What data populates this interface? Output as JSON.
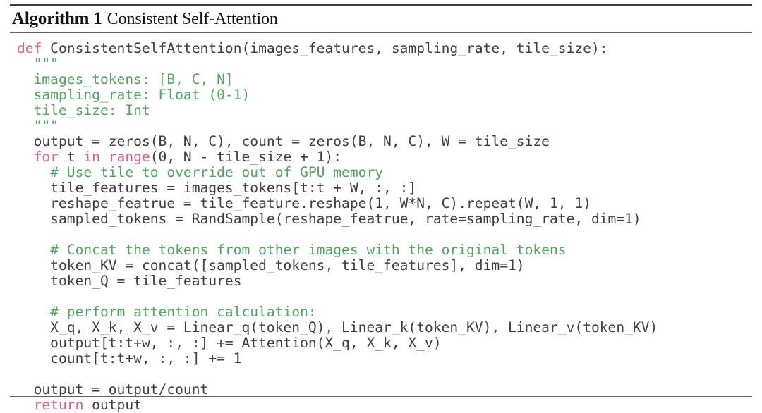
{
  "algorithm": {
    "label": "Algorithm 1",
    "caption": "Consistent Self-Attention",
    "colors": {
      "keyword": "#e0608f",
      "comment": "#51a75f",
      "docstring": "#51a75f",
      "code": "#3c4043",
      "rule": "#5d6266",
      "background": "#ffffff"
    },
    "language": "python",
    "code_lines": [
      {
        "index": 1,
        "text": "def ConsistentSelfAttention(images_features, sampling_rate, tile_size):",
        "segments": [
          {
            "kind": "keyword",
            "text": "def"
          },
          {
            "kind": "code",
            "text": " ConsistentSelfAttention(images_features, sampling_rate, tile_size):"
          }
        ]
      },
      {
        "index": 2,
        "text": "  \"\"\"",
        "segments": [
          {
            "kind": "docstring",
            "text": "  \"\"\""
          }
        ]
      },
      {
        "index": 3,
        "text": "  images_tokens: [B, C, N]",
        "segments": [
          {
            "kind": "docstring",
            "text": "  images_tokens: [B, C, N]"
          }
        ]
      },
      {
        "index": 4,
        "text": "  sampling_rate: Float (0-1)",
        "segments": [
          {
            "kind": "docstring",
            "text": "  sampling_rate: Float (0-1)"
          }
        ]
      },
      {
        "index": 5,
        "text": "  tile_size: Int",
        "segments": [
          {
            "kind": "docstring",
            "text": "  tile_size: Int"
          }
        ]
      },
      {
        "index": 6,
        "text": "  \"\"\"",
        "segments": [
          {
            "kind": "docstring",
            "text": "  \"\"\""
          }
        ]
      },
      {
        "index": 7,
        "text": "  output = zeros(B, N, C), count = zeros(B, N, C), W = tile_size",
        "segments": [
          {
            "kind": "code",
            "text": "  output = zeros(B, N, C), count = zeros(B, N, C), W = tile_size"
          }
        ]
      },
      {
        "index": 8,
        "text": "  for t in range(0, N - tile_size + 1):",
        "segments": [
          {
            "kind": "code",
            "text": "  "
          },
          {
            "kind": "keyword",
            "text": "for"
          },
          {
            "kind": "code",
            "text": " t "
          },
          {
            "kind": "keyword",
            "text": "in"
          },
          {
            "kind": "code",
            "text": " "
          },
          {
            "kind": "keyword",
            "text": "range"
          },
          {
            "kind": "code",
            "text": "(0, N - tile_size + 1):"
          }
        ]
      },
      {
        "index": 9,
        "text": "    # Use tile to override out of GPU memory",
        "segments": [
          {
            "kind": "comment",
            "text": "    # Use tile to override out of GPU memory"
          }
        ]
      },
      {
        "index": 10,
        "text": "    tile_features = images_tokens[t:t + W, :, :]",
        "segments": [
          {
            "kind": "code",
            "text": "    tile_features = images_tokens[t:t + W, :, :]"
          }
        ]
      },
      {
        "index": 11,
        "text": "    reshape_featrue = tile_feature.reshape(1, W*N, C).repeat(W, 1, 1)",
        "segments": [
          {
            "kind": "code",
            "text": "    reshape_featrue = tile_feature.reshape(1, W*N, C).repeat(W, 1, 1)"
          }
        ]
      },
      {
        "index": 12,
        "text": "    sampled_tokens = RandSample(reshape_featrue, rate=sampling_rate, dim=1)",
        "segments": [
          {
            "kind": "code",
            "text": "    sampled_tokens = RandSample(reshape_featrue, rate=sampling_rate, dim=1)"
          }
        ]
      },
      {
        "index": 13,
        "text": "",
        "segments": []
      },
      {
        "index": 14,
        "text": "    # Concat the tokens from other images with the original tokens",
        "segments": [
          {
            "kind": "comment",
            "text": "    # Concat the tokens from other images with the original tokens"
          }
        ]
      },
      {
        "index": 15,
        "text": "    token_KV = concat([sampled_tokens, tile_features], dim=1)",
        "segments": [
          {
            "kind": "code",
            "text": "    token_KV = concat([sampled_tokens, tile_features], dim=1)"
          }
        ]
      },
      {
        "index": 16,
        "text": "    token_Q = tile_features",
        "segments": [
          {
            "kind": "code",
            "text": "    token_Q = tile_features"
          }
        ]
      },
      {
        "index": 17,
        "text": "",
        "segments": []
      },
      {
        "index": 18,
        "text": "    # perform attention calculation:",
        "segments": [
          {
            "kind": "comment",
            "text": "    # perform attention calculation:"
          }
        ]
      },
      {
        "index": 19,
        "text": "    X_q, X_k, X_v = Linear_q(token_Q), Linear_k(token_KV), Linear_v(token_KV)",
        "segments": [
          {
            "kind": "code",
            "text": "    X_q, X_k, X_v = Linear_q(token_Q), Linear_k(token_KV), Linear_v(token_KV)"
          }
        ]
      },
      {
        "index": 20,
        "text": "    output[t:t+w, :, :] += Attention(X_q, X_k, X_v)",
        "segments": [
          {
            "kind": "code",
            "text": "    output[t:t+w, :, :] += Attention(X_q, X_k, X_v)"
          }
        ]
      },
      {
        "index": 21,
        "text": "    count[t:t+w, :, :] += 1",
        "segments": [
          {
            "kind": "code",
            "text": "    count[t:t+w, :, :] += 1"
          }
        ]
      },
      {
        "index": 22,
        "text": "",
        "segments": []
      },
      {
        "index": 23,
        "text": "  output = output/count",
        "segments": [
          {
            "kind": "code",
            "text": "  output = output/count"
          }
        ]
      },
      {
        "index": 24,
        "text": "  return output",
        "segments": [
          {
            "kind": "code",
            "text": "  "
          },
          {
            "kind": "keyword",
            "text": "return"
          },
          {
            "kind": "code",
            "text": " output"
          }
        ]
      }
    ]
  }
}
